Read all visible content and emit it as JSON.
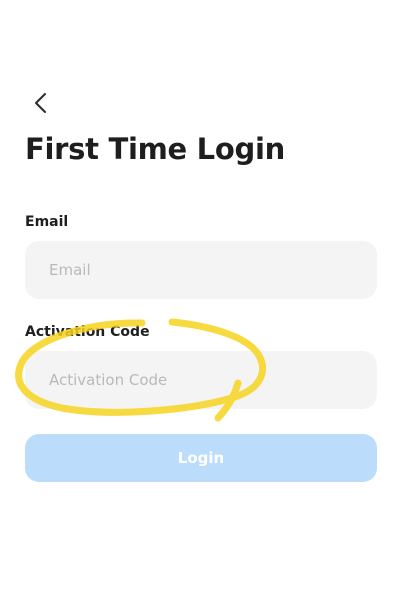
{
  "header": {
    "back_icon": "chevron-left-icon",
    "title": "First Time Login"
  },
  "form": {
    "email_label": "Email",
    "email_placeholder": "Email",
    "email_value": "",
    "code_label": "Activation Code",
    "code_placeholder": "Activation Code",
    "code_value": "",
    "login_label": "Login"
  },
  "colors": {
    "input_background": "#f4f4f5",
    "login_button_disabled": "#bcdcfb",
    "annotation_highlight": "#f6d21f",
    "title_text": "#1e1e1e"
  }
}
